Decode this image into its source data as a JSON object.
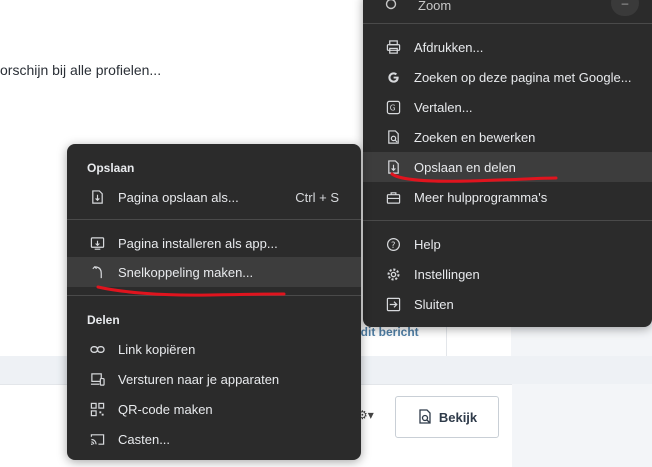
{
  "background": {
    "text_line": "orschijn bij alle profielen...",
    "link_text": "er dit bericht",
    "button_label": "Bekijk"
  },
  "main_menu": {
    "zoom_label": "Zoom",
    "items": [
      {
        "label": "Afdrukken...",
        "icon": "printer-icon"
      },
      {
        "label": "Zoeken op deze pagina met Google...",
        "icon": "google-icon"
      },
      {
        "label": "Vertalen...",
        "icon": "translate-icon"
      },
      {
        "label": "Zoeken en bewerken",
        "icon": "find-edit-icon"
      },
      {
        "label": "Opslaan en delen",
        "icon": "save-share-icon"
      },
      {
        "label": "Meer hulpprogramma's",
        "icon": "toolbox-icon"
      },
      {
        "label": "Help",
        "icon": "help-icon"
      },
      {
        "label": "Instellingen",
        "icon": "gear-icon"
      },
      {
        "label": "Sluiten",
        "icon": "exit-icon"
      }
    ]
  },
  "sub_menu": {
    "save_section": "Opslaan",
    "share_section": "Delen",
    "items": [
      {
        "label": "Pagina opslaan als...",
        "shortcut": "Ctrl + S",
        "icon": "save-page-icon"
      },
      {
        "label": "Pagina installeren als app...",
        "icon": "install-app-icon"
      },
      {
        "label": "Snelkoppeling maken...",
        "icon": "shortcut-icon"
      },
      {
        "label": "Link kopiëren",
        "icon": "link-icon"
      },
      {
        "label": "Versturen naar je apparaten",
        "icon": "devices-icon"
      },
      {
        "label": "QR-code maken",
        "icon": "qr-code-icon"
      },
      {
        "label": "Casten...",
        "icon": "cast-icon"
      }
    ]
  },
  "colors": {
    "menu_bg": "#2b2b2b",
    "highlight": "#3d3d3d",
    "annotation": "#e0141e"
  }
}
